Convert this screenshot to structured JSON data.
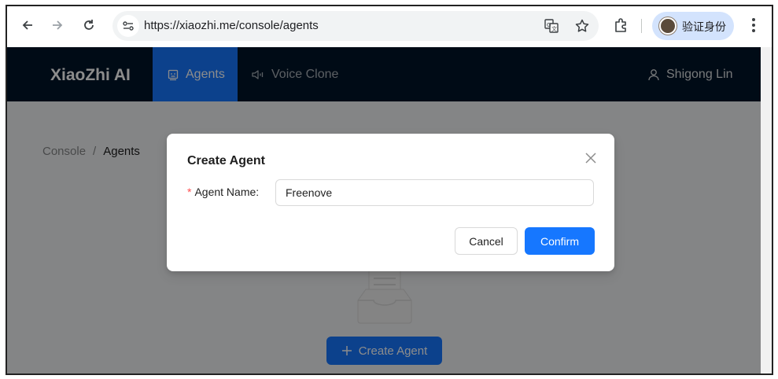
{
  "browser": {
    "url": "https://xiaozhi.me/console/agents",
    "profile_label": "验证身份"
  },
  "app": {
    "brand": "XiaoZhi AI",
    "nav": [
      {
        "label": "Agents",
        "icon": "robot-icon",
        "active": true
      },
      {
        "label": "Voice Clone",
        "icon": "sound-icon",
        "active": false
      }
    ],
    "user_name": "Shigong Lin"
  },
  "breadcrumb": {
    "root": "Console",
    "separator": "/",
    "current": "Agents"
  },
  "empty_state": {
    "create_button": "Create Agent"
  },
  "modal": {
    "title": "Create Agent",
    "required_mark": "*",
    "field_label": "Agent Name:",
    "field_value": "Freenove",
    "cancel_label": "Cancel",
    "confirm_label": "Confirm"
  },
  "colors": {
    "primary": "#1677ff",
    "header_bg": "#001529",
    "required": "#ff4d4f"
  }
}
